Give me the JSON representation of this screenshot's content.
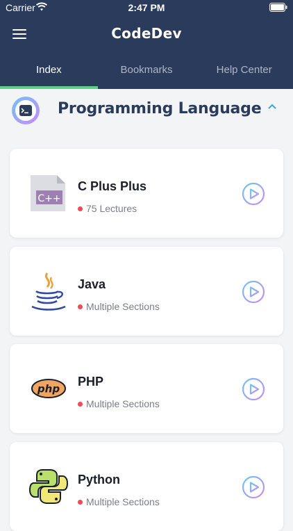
{
  "status": {
    "carrier": "Carrier",
    "time": "2:47 PM"
  },
  "app": {
    "title": "CodeDev"
  },
  "tabs": [
    {
      "label": "Index",
      "active": true
    },
    {
      "label": "Bookmarks",
      "active": false
    },
    {
      "label": "Help Center",
      "active": false
    }
  ],
  "section": {
    "title": "Programming Language"
  },
  "courses": [
    {
      "title": "C Plus Plus",
      "subtitle": "75 Lectures",
      "logo_text": "C++",
      "icon": "cpp-file-icon"
    },
    {
      "title": "Java",
      "subtitle": "Multiple Sections",
      "icon": "java-coffee-icon"
    },
    {
      "title": "PHP",
      "subtitle": "Multiple Sections",
      "logo_text": "php",
      "icon": "php-logo-icon"
    },
    {
      "title": "Python",
      "subtitle": "Multiple Sections",
      "icon": "python-logo-icon"
    }
  ],
  "colors": {
    "header": "#2b3b5c",
    "tab_indicator": "#5fd08a",
    "status_dot": "#ee4b55",
    "accent_gradient_start": "#6fc3f7",
    "accent_gradient_end": "#c78cf5"
  }
}
